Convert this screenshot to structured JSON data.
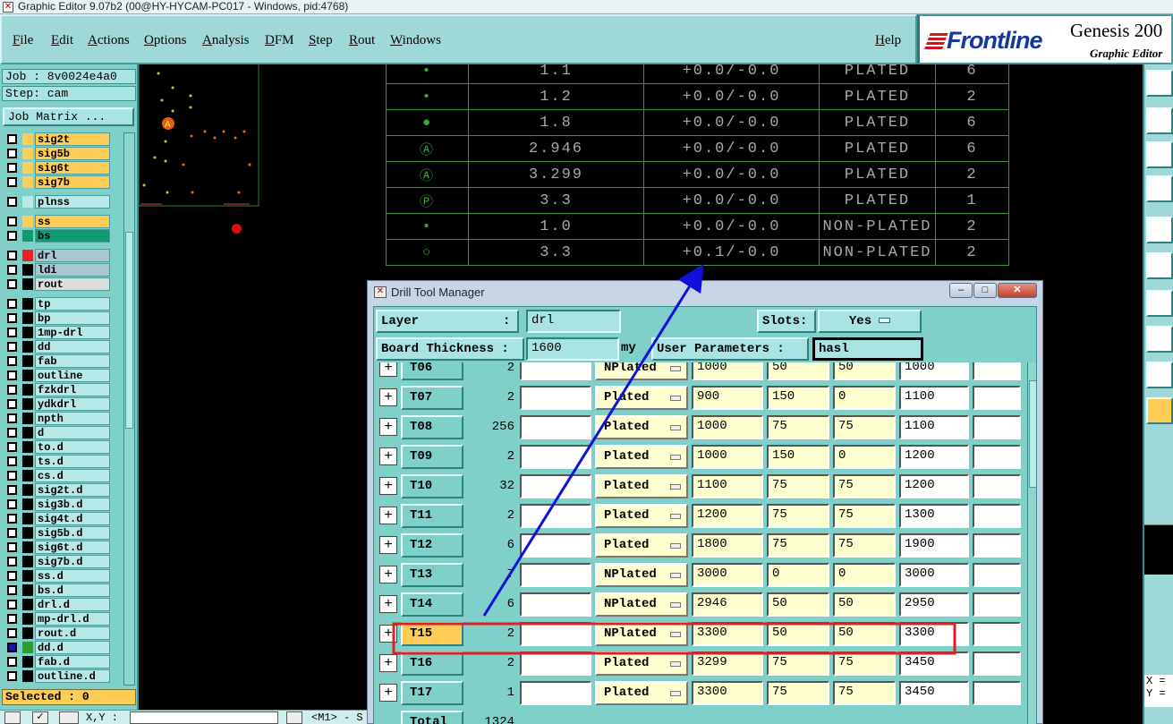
{
  "window": {
    "title": "Graphic Editor 9.07b2 (00@HY-HYCAM-PC017 - Windows, pid:4768)"
  },
  "menu": {
    "file": "File",
    "edit": "Edit",
    "actions": "Actions",
    "options": "Options",
    "analysis": "Analysis",
    "dfm": "DFM",
    "step": "Step",
    "rout": "Rout",
    "windows": "Windows",
    "help": "Help"
  },
  "brand": {
    "logo": "Frontline",
    "product": "Genesis 200",
    "subtitle": "Graphic Editor"
  },
  "panel": {
    "job": "Job : 8v0024e4a0",
    "step": "Step: cam",
    "job_matrix": "Job Matrix ...",
    "selected": "Selected : 0"
  },
  "layers": [
    {
      "name": "sig2t",
      "color": "#ffcc55",
      "bg": "#ffcc55"
    },
    {
      "name": "sig5b",
      "color": "#ffcc55",
      "bg": "#ffcc55"
    },
    {
      "name": "sig6t",
      "color": "#ffcc55",
      "bg": "#ffcc55"
    },
    {
      "name": "sig7b",
      "color": "#ffcc55",
      "bg": "#ffcc55"
    },
    {
      "name": "plnss",
      "color": "#b8e8e8",
      "bg": "#b8e8e8"
    },
    {
      "name": "ss",
      "color": "#ffcc55",
      "bg": "#ffcc55"
    },
    {
      "name": "bs",
      "color": "#109a70",
      "bg": "#109a70"
    },
    {
      "name": "drl",
      "color": "#ee2020",
      "bg": "#a9c6d3"
    },
    {
      "name": "ldi",
      "color": "#000000",
      "bg": "#a9c6d3"
    },
    {
      "name": "rout",
      "color": "#000000",
      "bg": "#dddddd"
    },
    {
      "name": "tp",
      "color": "#000000",
      "bg": "#b8e8e8"
    },
    {
      "name": "bp",
      "color": "#000000",
      "bg": "#b8e8e8"
    },
    {
      "name": "1mp-drl",
      "color": "#000000",
      "bg": "#b8e8e8"
    },
    {
      "name": "dd",
      "color": "#000000",
      "bg": "#b8e8e8"
    },
    {
      "name": "fab",
      "color": "#000000",
      "bg": "#b8e8e8"
    },
    {
      "name": "outline",
      "color": "#000000",
      "bg": "#b8e8e8"
    },
    {
      "name": "fzkdrl",
      "color": "#000000",
      "bg": "#b8e8e8"
    },
    {
      "name": "ydkdrl",
      "color": "#000000",
      "bg": "#b8e8e8"
    },
    {
      "name": "npth",
      "color": "#000000",
      "bg": "#b8e8e8"
    },
    {
      "name": "d",
      "color": "#000000",
      "bg": "#b8e8e8"
    },
    {
      "name": "to.d",
      "color": "#000000",
      "bg": "#b8e8e8"
    },
    {
      "name": "ts.d",
      "color": "#000000",
      "bg": "#b8e8e8"
    },
    {
      "name": "cs.d",
      "color": "#000000",
      "bg": "#b8e8e8"
    },
    {
      "name": "sig2t.d",
      "color": "#000000",
      "bg": "#b8e8e8"
    },
    {
      "name": "sig3b.d",
      "color": "#000000",
      "bg": "#b8e8e8"
    },
    {
      "name": "sig4t.d",
      "color": "#000000",
      "bg": "#b8e8e8"
    },
    {
      "name": "sig5b.d",
      "color": "#000000",
      "bg": "#b8e8e8"
    },
    {
      "name": "sig6t.d",
      "color": "#000000",
      "bg": "#b8e8e8"
    },
    {
      "name": "sig7b.d",
      "color": "#000000",
      "bg": "#b8e8e8"
    },
    {
      "name": "ss.d",
      "color": "#000000",
      "bg": "#b8e8e8"
    },
    {
      "name": "bs.d",
      "color": "#000000",
      "bg": "#b8e8e8"
    },
    {
      "name": "drl.d",
      "color": "#000000",
      "bg": "#b8e8e8"
    },
    {
      "name": "mp-drl.d",
      "color": "#000000",
      "bg": "#b8e8e8"
    },
    {
      "name": "rout.d",
      "color": "#000000",
      "bg": "#b8e8e8"
    },
    {
      "name": "dd.d",
      "color": "#2aa02a",
      "bg": "#b8e8e8"
    },
    {
      "name": "fab.d",
      "color": "#000000",
      "bg": "#b8e8e8"
    },
    {
      "name": "outline.d",
      "color": "#000000",
      "bg": "#b8e8e8"
    }
  ],
  "drill_table": [
    {
      "size": "1.1",
      "tol": "+0.0/-0.0",
      "type": "PLATED",
      "count": "6"
    },
    {
      "size": "1.2",
      "tol": "+0.0/-0.0",
      "type": "PLATED",
      "count": "2"
    },
    {
      "size": "1.8",
      "tol": "+0.0/-0.0",
      "type": "PLATED",
      "count": "6"
    },
    {
      "size": "2.946",
      "tol": "+0.0/-0.0",
      "type": "PLATED",
      "count": "6"
    },
    {
      "size": "3.299",
      "tol": "+0.0/-0.0",
      "type": "PLATED",
      "count": "2"
    },
    {
      "size": "3.3",
      "tol": "+0.0/-0.0",
      "type": "PLATED",
      "count": "1"
    },
    {
      "size": "1.0",
      "tol": "+0.0/-0.0",
      "type": "NON-PLATED",
      "count": "2"
    },
    {
      "size": "3.3",
      "tol": "+0.1/-0.0",
      "type": "NON-PLATED",
      "count": "2"
    }
  ],
  "dtm": {
    "title": "Drill Tool Manager",
    "layer_label": "Layer",
    "layer_colon": ":",
    "layer_value": "drl",
    "slots_label": "Slots:",
    "slots_value": "Yes",
    "thickness_label": "Board Thickness :",
    "thickness_value": "1600",
    "thickness_unit": "my",
    "user_params_label": "User Parameters :",
    "user_params_value": "hasl",
    "total_label": "Total",
    "total_value": "1324",
    "tools": [
      {
        "name": "T06",
        "count": "2",
        "type": "NPlated",
        "finish": "1000",
        "tplus": "50",
        "tminus": "50",
        "drill": "1000"
      },
      {
        "name": "T07",
        "count": "2",
        "type": "Plated",
        "finish": "900",
        "tplus": "150",
        "tminus": "0",
        "drill": "1100"
      },
      {
        "name": "T08",
        "count": "256",
        "type": "Plated",
        "finish": "1000",
        "tplus": "75",
        "tminus": "75",
        "drill": "1100"
      },
      {
        "name": "T09",
        "count": "2",
        "type": "Plated",
        "finish": "1000",
        "tplus": "150",
        "tminus": "0",
        "drill": "1200"
      },
      {
        "name": "T10",
        "count": "32",
        "type": "Plated",
        "finish": "1100",
        "tplus": "75",
        "tminus": "75",
        "drill": "1200"
      },
      {
        "name": "T11",
        "count": "2",
        "type": "Plated",
        "finish": "1200",
        "tplus": "75",
        "tminus": "75",
        "drill": "1300"
      },
      {
        "name": "T12",
        "count": "6",
        "type": "Plated",
        "finish": "1800",
        "tplus": "75",
        "tminus": "75",
        "drill": "1900"
      },
      {
        "name": "T13",
        "count": "7",
        "type": "NPlated",
        "finish": "3000",
        "tplus": "0",
        "tminus": "0",
        "drill": "3000"
      },
      {
        "name": "T14",
        "count": "6",
        "type": "NPlated",
        "finish": "2946",
        "tplus": "50",
        "tminus": "50",
        "drill": "2950"
      },
      {
        "name": "T15",
        "count": "2",
        "type": "NPlated",
        "finish": "3300",
        "tplus": "50",
        "tminus": "50",
        "drill": "3300"
      },
      {
        "name": "T16",
        "count": "2",
        "type": "Plated",
        "finish": "3299",
        "tplus": "75",
        "tminus": "75",
        "drill": "3450"
      },
      {
        "name": "T17",
        "count": "1",
        "type": "Plated",
        "finish": "3300",
        "tplus": "75",
        "tminus": "75",
        "drill": "3450"
      }
    ]
  },
  "bottom": {
    "xy_label": "X,Y :",
    "hint": "<M1> - S"
  },
  "readout": {
    "x_label": "X =",
    "y_label": "Y ="
  },
  "annotations": {
    "highlight_color": "#e02020",
    "arrow_color": "#1010dd"
  }
}
